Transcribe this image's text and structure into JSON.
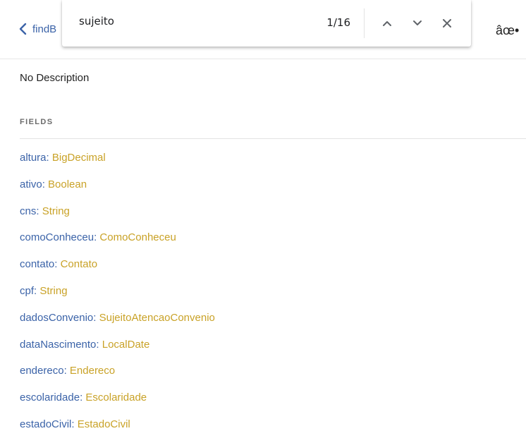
{
  "header": {
    "back_label": "findB",
    "right_glyph": "âœ•"
  },
  "find_bar": {
    "query": "sujeito",
    "count": "1/16",
    "prev_icon": "chevron-up-icon",
    "next_icon": "chevron-down-icon",
    "close_icon": "close-icon"
  },
  "description": "No Description",
  "fields_title": "FIELDS",
  "fields": [
    {
      "name": "altura",
      "type": "BigDecimal"
    },
    {
      "name": "ativo",
      "type": "Boolean"
    },
    {
      "name": "cns",
      "type": "String"
    },
    {
      "name": "comoConheceu",
      "type": "ComoConheceu"
    },
    {
      "name": "contato",
      "type": "Contato"
    },
    {
      "name": "cpf",
      "type": "String"
    },
    {
      "name": "dadosConvenio",
      "type": "SujeitoAtencaoConvenio"
    },
    {
      "name": "dataNascimento",
      "type": "LocalDate"
    },
    {
      "name": "endereco",
      "type": "Endereco"
    },
    {
      "name": "escolaridade",
      "type": "Escolaridade"
    },
    {
      "name": "estadoCivil",
      "type": "EstadoCivil"
    }
  ],
  "colors": {
    "field_name": "#3b63a8",
    "field_type": "#c9a227",
    "text": "#222222"
  }
}
